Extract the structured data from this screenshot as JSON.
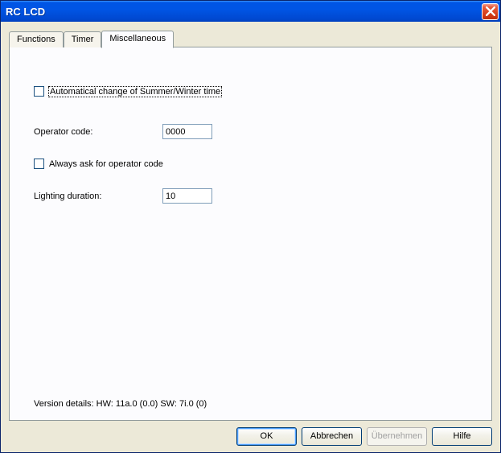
{
  "window": {
    "title": "RC LCD"
  },
  "tabs": {
    "functions": "Functions",
    "timer": "Timer",
    "misc": "Miscellaneous"
  },
  "form": {
    "auto_summer_winter_label": "Automatical change of Summer/Winter time",
    "operator_code_label": "Operator code:",
    "operator_code_value": "0000",
    "always_ask_label": "Always ask for operator code",
    "lighting_duration_label": "Lighting duration:",
    "lighting_duration_value": "10"
  },
  "version": {
    "text": "Version details:   HW: 11a.0 (0.0)  SW: 7i.0 (0)"
  },
  "buttons": {
    "ok": "OK",
    "cancel": "Abbrechen",
    "apply": "Übernehmen",
    "help": "Hilfe"
  }
}
